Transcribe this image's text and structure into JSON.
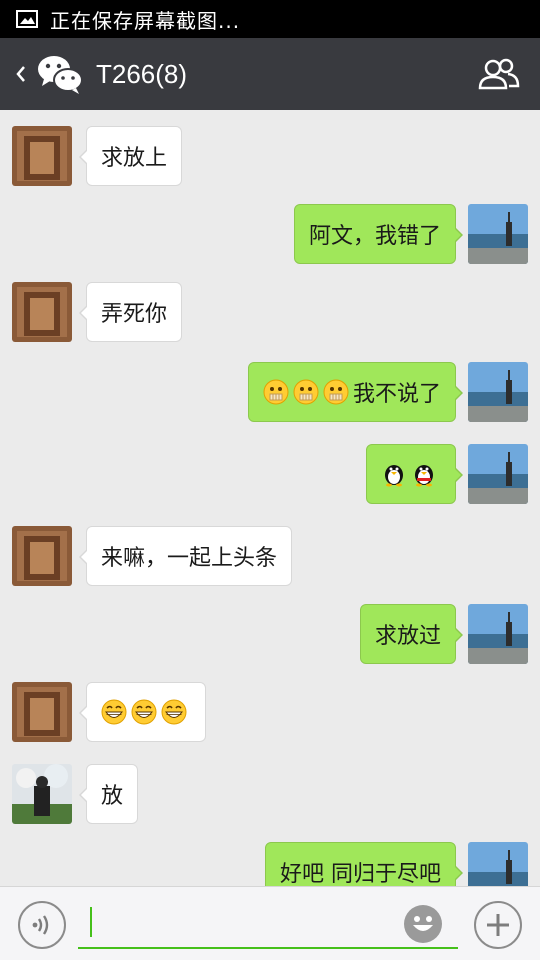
{
  "status_bar": {
    "text": "正在保存屏幕截图..."
  },
  "header": {
    "title": "T266(8)"
  },
  "messages": [
    {
      "side": "left",
      "text": "求放上",
      "avatar": "avatar-a"
    },
    {
      "side": "right",
      "text": "阿文，我错了",
      "avatar": "avatar-me"
    },
    {
      "side": "left",
      "text": "弄死你",
      "avatar": "avatar-a"
    },
    {
      "side": "right",
      "text": "我不说了",
      "emojis": [
        "mouth-zipped-emoji",
        "mouth-zipped-emoji",
        "mouth-zipped-emoji"
      ],
      "avatar": "avatar-me"
    },
    {
      "side": "right",
      "text": "",
      "emojis": [
        "penguin-emoji",
        "penguin-emoji"
      ],
      "avatar": "avatar-me"
    },
    {
      "side": "left",
      "text": "来嘛，一起上头条",
      "avatar": "avatar-a"
    },
    {
      "side": "right",
      "text": "求放过",
      "avatar": "avatar-me"
    },
    {
      "side": "left",
      "text": "",
      "emojis": [
        "grin-emoji",
        "grin-emoji",
        "grin-emoji"
      ],
      "avatar": "avatar-a"
    },
    {
      "side": "left",
      "text": "放",
      "avatar": "avatar-b"
    },
    {
      "side": "right",
      "text": "好吧 同归于尽吧",
      "avatar": "avatar-me"
    }
  ],
  "input_bar": {
    "value": ""
  },
  "colors": {
    "header_bg": "#393a3f",
    "chat_bg": "#ebebeb",
    "own_bubble": "#a0e75a",
    "accent": "#45c01a"
  }
}
